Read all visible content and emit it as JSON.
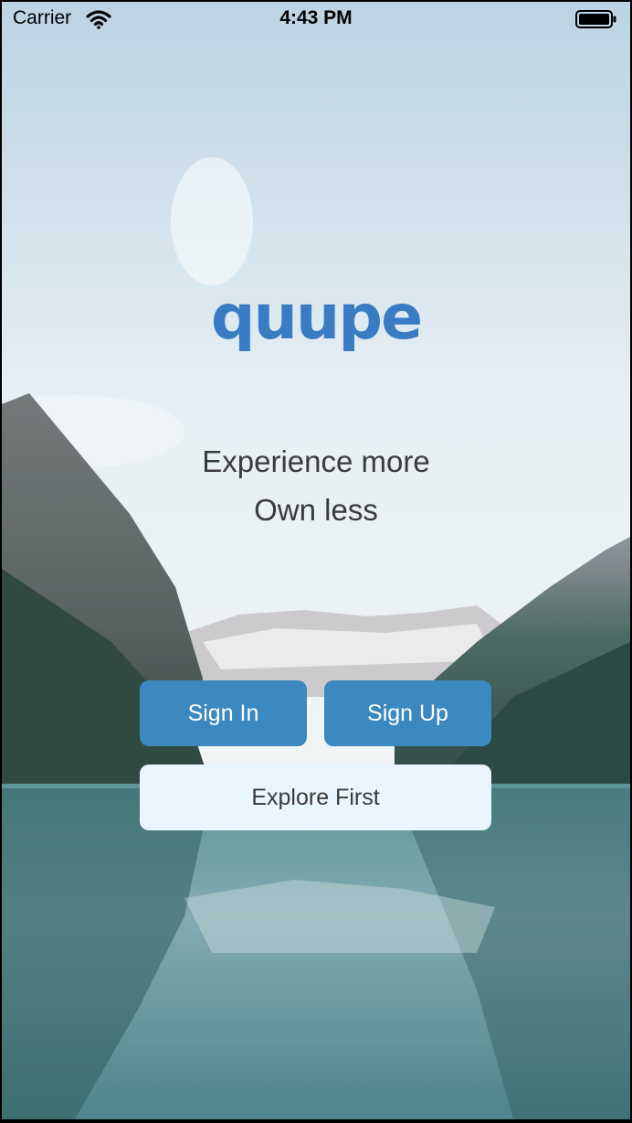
{
  "status_bar": {
    "carrier": "Carrier",
    "time": "4:43 PM",
    "wifi_icon": "wifi-icon",
    "battery_icon": "battery-icon"
  },
  "brand": {
    "logo_text": "quupe",
    "logo_color": "#3a7cc4"
  },
  "tagline": {
    "line1": "Experience more",
    "line2": "Own less"
  },
  "actions": {
    "sign_in": "Sign In",
    "sign_up": "Sign Up",
    "explore": "Explore First",
    "primary_color": "#3b89c0",
    "secondary_color": "#e9f5ff"
  }
}
